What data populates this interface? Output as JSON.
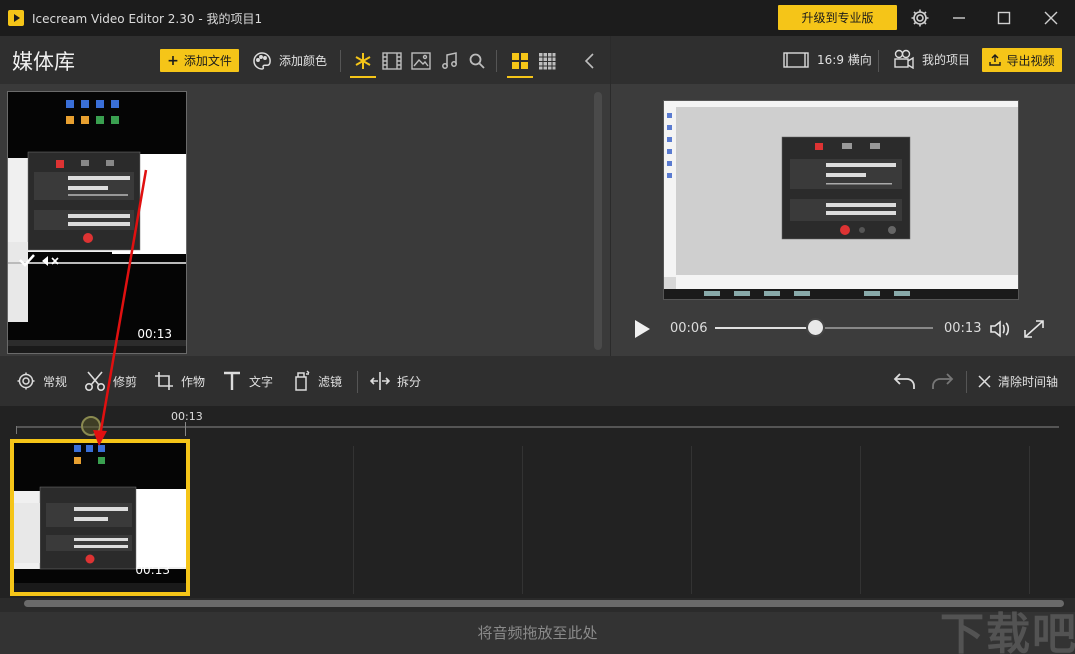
{
  "window": {
    "title": "Icecream Video Editor 2.30 - 我的项目1",
    "upgrade_label": "升级到专业版"
  },
  "library": {
    "title": "媒体库",
    "add_file_label": "添加文件",
    "add_color_label": "添加颜色",
    "items": [
      {
        "duration": "00:13"
      }
    ]
  },
  "preview": {
    "aspect_label": "16:9 横向",
    "my_project_label": "我的项目",
    "export_label": "导出视频",
    "current_time": "00:06",
    "total_time": "00:13",
    "progress": 0.46
  },
  "toolbar": {
    "general": "常规",
    "trim": "修剪",
    "crop": "作物",
    "text": "文字",
    "filter": "滤镜",
    "split": "拆分",
    "clear_timeline": "清除时间轴"
  },
  "timeline": {
    "ruler_label": "00:13",
    "clips": [
      {
        "duration": "00:13"
      }
    ]
  },
  "audio": {
    "hint": "将音频拖放至此处"
  },
  "watermark": "下载吧",
  "colors": {
    "accent": "#f5c518",
    "arrow": "#e01010"
  }
}
